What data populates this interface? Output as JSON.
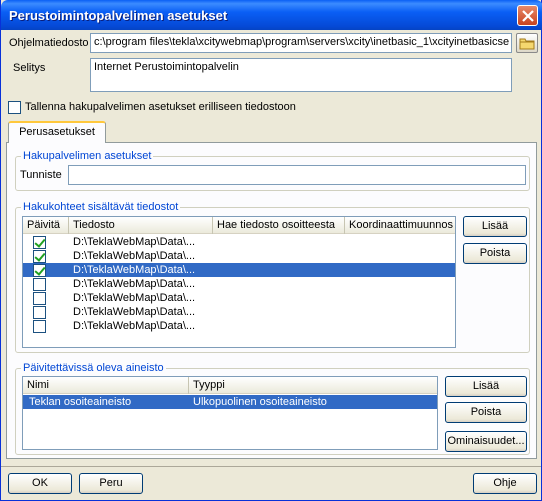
{
  "window": {
    "title": "Perustoimintopalvelimen asetukset"
  },
  "fields": {
    "program_label": "Ohjelmatiedosto",
    "program_value": "c:\\program files\\tekla\\xcitywebmap\\program\\servers\\xcity\\inetbasic_1\\xcityinetbasicse",
    "desc_label": "Selitys",
    "desc_value": "Internet Perustoimintopalvelin"
  },
  "separate_settings": {
    "label": "Tallenna hakupalvelimen asetukset erilliseen tiedostoon",
    "checked": false
  },
  "tabs": [
    {
      "label": "Perusasetukset",
      "active": true
    }
  ],
  "search_server": {
    "group_title": "Hakupalvelimen asetukset",
    "id_label": "Tunniste",
    "id_value": ""
  },
  "files": {
    "group_title": "Hakukohteet sisältävät tiedostot",
    "columns": [
      "Päivitä",
      "Tiedosto",
      "Hae tiedosto osoitteesta",
      "Koordinaattimuunnos"
    ],
    "rows": [
      {
        "update": true,
        "file": "D:\\TeklaWebMap\\Data\\...",
        "selected": false
      },
      {
        "update": true,
        "file": "D:\\TeklaWebMap\\Data\\...",
        "selected": false
      },
      {
        "update": true,
        "file": "D:\\TeklaWebMap\\Data\\...",
        "selected": true
      },
      {
        "update": false,
        "file": "D:\\TeklaWebMap\\Data\\...",
        "selected": false
      },
      {
        "update": false,
        "file": "D:\\TeklaWebMap\\Data\\...",
        "selected": false
      },
      {
        "update": false,
        "file": "D:\\TeklaWebMap\\Data\\...",
        "selected": false
      },
      {
        "update": false,
        "file": "D:\\TeklaWebMap\\Data\\...",
        "selected": false
      }
    ],
    "add_label": "Lisää",
    "remove_label": "Poista"
  },
  "material": {
    "group_title": "Päivitettävissä oleva aineisto",
    "columns": [
      "Nimi",
      "Tyyppi"
    ],
    "rows": [
      {
        "name": "Teklan osoiteaineisto",
        "type": "Ulkopuolinen osoiteaineisto",
        "selected": true
      }
    ],
    "add_label": "Lisää",
    "remove_label": "Poista",
    "properties_label": "Ominaisuudet..."
  },
  "footer": {
    "ok_label": "OK",
    "cancel_label": "Peru",
    "help_label": "Ohje"
  },
  "icons": {
    "close": "close-icon",
    "folder": "folder-icon"
  },
  "colors": {
    "title_bar": "#0a5ff5",
    "selection": "#316ac5",
    "group_title": "#0046d5",
    "check": "#21a121"
  }
}
